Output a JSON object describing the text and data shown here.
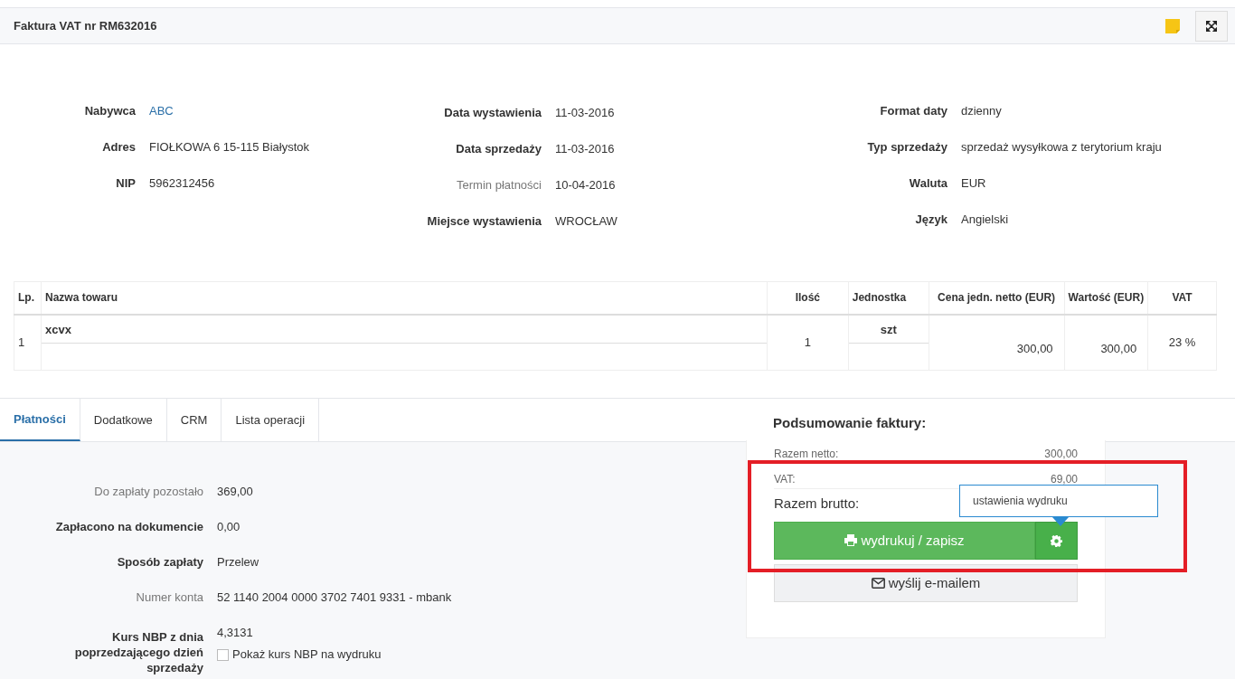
{
  "header": {
    "title": "Faktura VAT nr RM632016"
  },
  "info_columns": [
    [
      {
        "label": "Nabywca",
        "value": "ABC",
        "bold": true,
        "link": true
      },
      {
        "label": "Adres",
        "value": "FIOŁKOWA 6 15-115 Białystok",
        "bold": true,
        "link": false
      },
      {
        "label": "NIP",
        "value": "5962312456",
        "bold": true,
        "link": false
      }
    ],
    [
      {
        "label": "Data wystawienia",
        "value": "11-03-2016",
        "bold": true,
        "link": false
      },
      {
        "label": "Data sprzedaży",
        "value": "11-03-2016",
        "bold": true,
        "link": false
      },
      {
        "label": "Termin płatności",
        "value": "10-04-2016",
        "bold": false,
        "link": false
      },
      {
        "label": "Miejsce wystawienia",
        "value": "WROCŁAW",
        "bold": true,
        "link": false
      }
    ],
    [
      {
        "label": "Format daty",
        "value": "dzienny",
        "bold": true,
        "link": false
      },
      {
        "label": "Typ sprzedaży",
        "value": "sprzedaż wysyłkowa z terytorium kraju",
        "bold": true,
        "link": false
      },
      {
        "label": "Waluta",
        "value": "EUR",
        "bold": true,
        "link": false
      },
      {
        "label": "Język",
        "value": "Angielski",
        "bold": true,
        "link": false
      }
    ]
  ],
  "table": {
    "columns": [
      "Lp.",
      "Nazwa towaru",
      "Ilość",
      "Jednostka",
      "Cena jedn. netto (EUR)",
      "Wartość (EUR)",
      "VAT"
    ],
    "rows": [
      {
        "lp": "1",
        "name": "xcvx",
        "quantity": "1",
        "unit": "szt",
        "unit_price": "300,00",
        "value": "300,00",
        "vat": "23 %"
      }
    ]
  },
  "tabs": [
    {
      "label": "Płatności",
      "selected": true
    },
    {
      "label": "Dodatkowe",
      "selected": false
    },
    {
      "label": "CRM",
      "selected": false
    },
    {
      "label": "Lista operacji",
      "selected": false
    }
  ],
  "payment": [
    {
      "label": "Do zapłaty pozostało",
      "value": "369,00",
      "bold": false
    },
    {
      "label": "Zapłacono na dokumencie",
      "value": "0,00",
      "bold": true
    },
    {
      "label": "Sposób zapłaty",
      "value": "Przelew",
      "bold": true
    },
    {
      "label": "Numer konta",
      "value": "52 1140 2004 0000 3702 7401 9331 - mbank",
      "bold": false
    },
    {
      "label": "Kurs NBP z dnia poprzedzającego dzień sprzedaży",
      "value": "4,3131",
      "bold": true,
      "checkbox": {
        "label": "Pokaż kurs NBP na wydruku",
        "checked": false
      }
    }
  ],
  "summary": {
    "title": "Podsumowanie faktury:",
    "rows": [
      {
        "label": "Razem netto:",
        "value": "300,00"
      },
      {
        "label": "VAT:",
        "value": "69,00"
      }
    ],
    "total_label": "Razem brutto:",
    "tooltip": "ustawienia wydruku",
    "print_button": "wydrukuj / zapisz",
    "email_button": "wyślij e-mailem"
  }
}
